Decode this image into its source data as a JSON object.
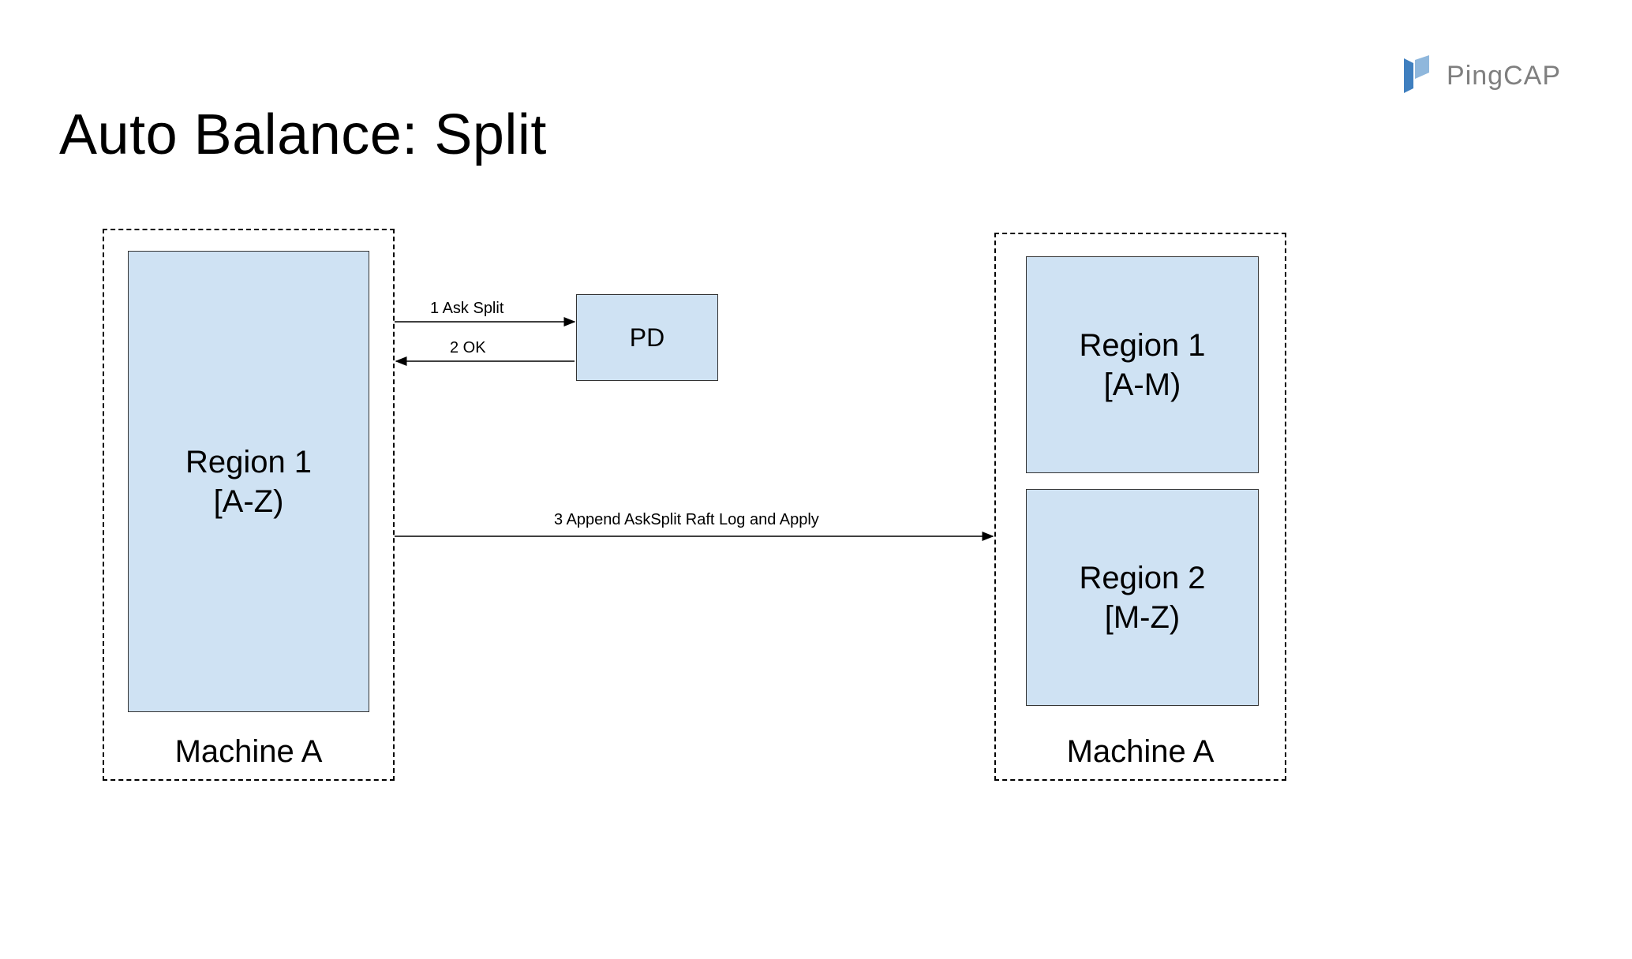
{
  "title": "Auto Balance: Split",
  "logo": {
    "text": "PingCAP"
  },
  "left_machine": {
    "label": "Machine A",
    "region": {
      "name": "Region 1",
      "range": "[A-Z)"
    }
  },
  "right_machine": {
    "label": "Machine A",
    "regions": [
      {
        "name": "Region 1",
        "range": "[A-M)"
      },
      {
        "name": "Region 2",
        "range": "[M-Z)"
      }
    ]
  },
  "pd": {
    "label": "PD"
  },
  "arrows": {
    "ask_split": "1 Ask Split",
    "ok": "2 OK",
    "append_apply": "3 Append AskSplit Raft Log and Apply"
  }
}
